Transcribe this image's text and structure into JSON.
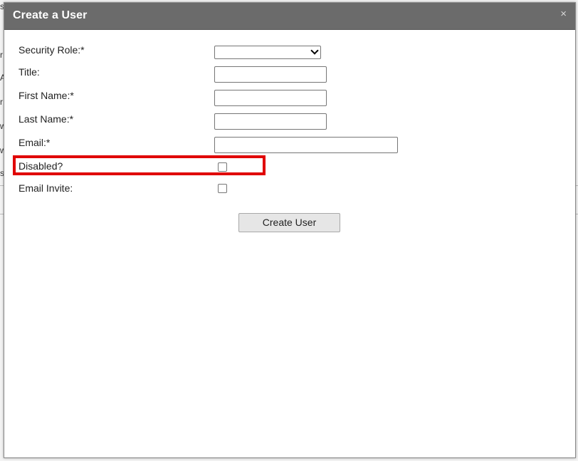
{
  "background_fragments": [
    "s",
    "r",
    "A",
    "r",
    "w",
    "v",
    "w",
    "s"
  ],
  "dialog": {
    "title": "Create a User",
    "close_glyph": "×"
  },
  "form": {
    "security_role": {
      "label": "Security Role:*",
      "value": ""
    },
    "title": {
      "label": "Title:",
      "value": ""
    },
    "first_name": {
      "label": "First Name:*",
      "value": ""
    },
    "last_name": {
      "label": "Last Name:*",
      "value": ""
    },
    "email": {
      "label": "Email:*",
      "value": ""
    },
    "disabled": {
      "label": "Disabled?",
      "checked": false
    },
    "email_invite": {
      "label": "Email Invite:",
      "checked": false
    }
  },
  "submit_label": "Create User",
  "colors": {
    "titlebar": "#6b6b6b",
    "highlight": "#e00000",
    "button": "#e6e6e6"
  }
}
